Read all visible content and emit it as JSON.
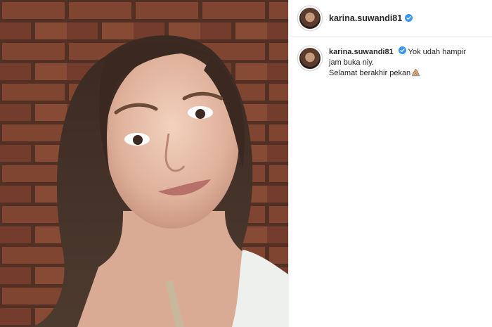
{
  "post": {
    "username": "karina.suwandi81",
    "verified": true,
    "caption_line1": "Yok udah hampir",
    "caption_line2": "jam buka niy.",
    "caption_line3": "Selamat berakhir pekan",
    "caption_emoji": "folded-hands-emoji"
  },
  "colors": {
    "verified_badge": "#3897f0",
    "divider": "#efefef",
    "brick": "#8a4a34",
    "mortar": "#5e3a2d"
  }
}
